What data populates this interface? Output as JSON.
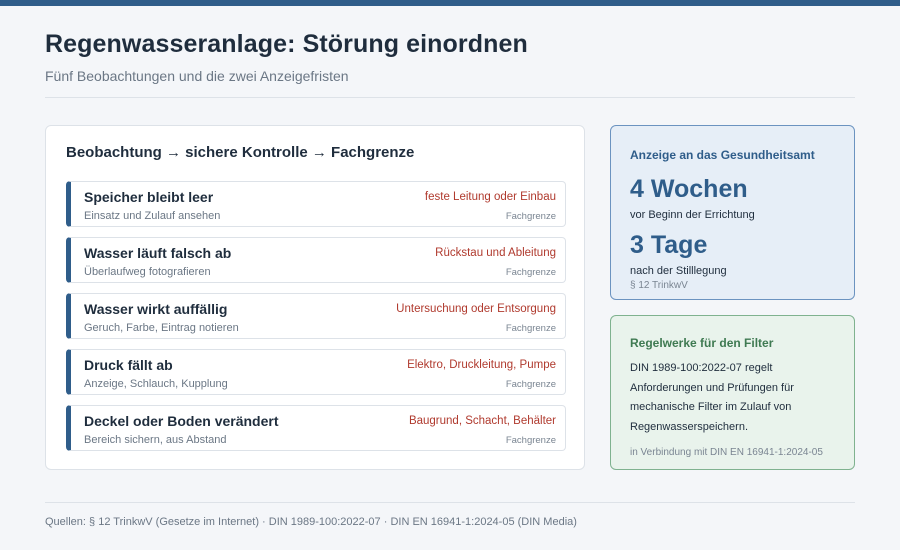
{
  "header": {
    "title": "Regenwasseranlage: Störung einordnen",
    "subtitle": "Fünf Beobachtungen und die zwei Anzeigefristen"
  },
  "main": {
    "heading": "Beobachtung → sichere Kontrolle → Fachgrenze",
    "items": [
      {
        "title": "Speicher bleibt leer",
        "check": "Einsatz und Zulauf ansehen",
        "limit": "feste Leitung oder Einbau",
        "tag": "Fachgrenze"
      },
      {
        "title": "Wasser läuft falsch ab",
        "check": "Überlaufweg fotografieren",
        "limit": "Rückstau und Ableitung",
        "tag": "Fachgrenze"
      },
      {
        "title": "Wasser wirkt auffällig",
        "check": "Geruch, Farbe, Eintrag notieren",
        "limit": "Untersuchung oder Entsorgung",
        "tag": "Fachgrenze"
      },
      {
        "title": "Druck fällt ab",
        "check": "Anzeige, Schlauch, Kupplung",
        "limit": "Elektro, Druckleitung, Pumpe",
        "tag": "Fachgrenze"
      },
      {
        "title": "Deckel oder Boden verändert",
        "check": "Bereich sichern, aus Abstand",
        "limit": "Baugrund, Schacht, Behälter",
        "tag": "Fachgrenze"
      }
    ]
  },
  "notice": {
    "heading": "Anzeige an das Gesundheitsamt",
    "value1": "4 Wochen",
    "desc1": "vor Beginn der Errichtung",
    "value2": "3 Tage",
    "desc2": "nach der Stilllegung",
    "source": "§ 12 TrinkwV"
  },
  "filter": {
    "heading": "Regelwerke für den Filter",
    "text": "DIN 1989-100:2022-07 regelt Anforderungen und Prüfungen für mechanische Filter im Zulauf von Regenwasserspeichern.",
    "note": "in Verbindung mit DIN EN 16941-1:2024-05"
  },
  "footer": {
    "sources": "Quellen: § 12 TrinkwV (Gesetze im Internet) · DIN 1989-100:2022-07 · DIN EN 16941-1:2024-05 (DIN Media)"
  },
  "colors": {
    "accent": "#2f5d8a",
    "limit": "#b03a2e",
    "filter": "#3f7a52"
  }
}
